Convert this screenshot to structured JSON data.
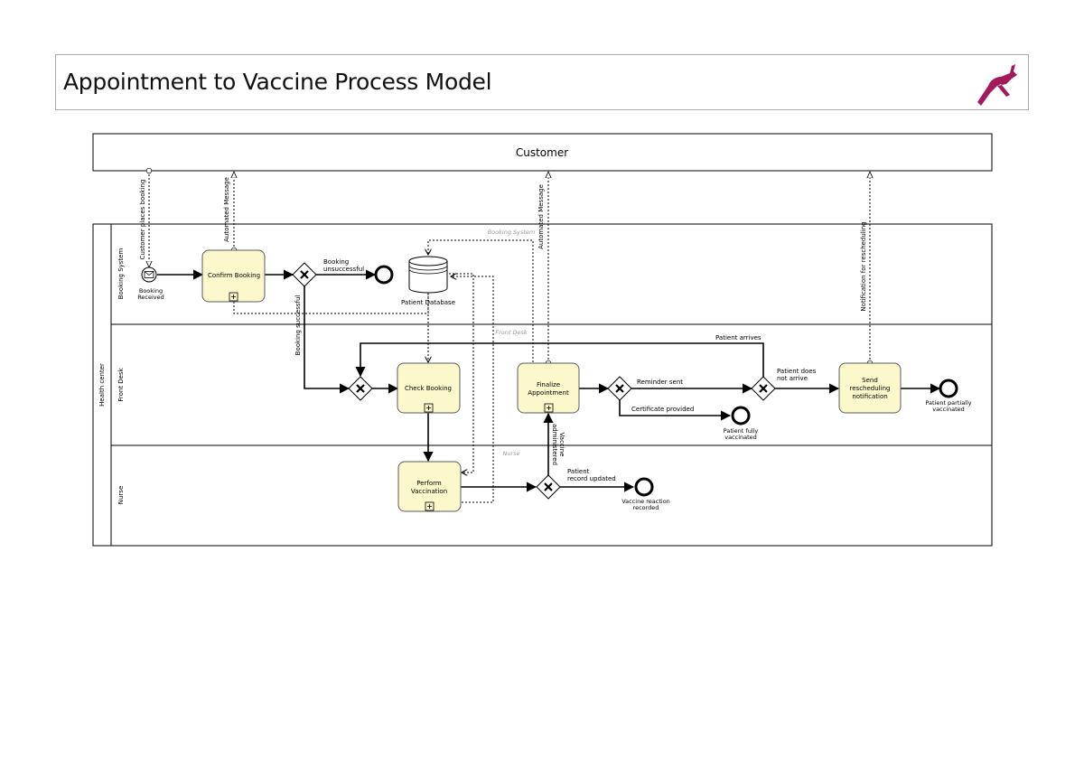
{
  "header": {
    "title": "Appointment to Vaccine Process Model",
    "logo_icon": "leaping-antelope-logo",
    "logo_color": "#a3195b"
  },
  "pools": {
    "customer": "Customer",
    "health_center": "Health center"
  },
  "lanes": {
    "booking_system": "Booking System",
    "front_desk": "Front Desk",
    "nurse": "Nurse"
  },
  "lane_watermarks": {
    "booking_system": "Booking System",
    "front_desk": "Front Desk",
    "nurse": "Nurse"
  },
  "tasks": {
    "confirm_booking": "Confirm Booking",
    "check_booking": "Check Booking",
    "finalize_appointment": [
      "Finalize",
      "Appointment"
    ],
    "perform_vaccination": [
      "Perform",
      "Vaccination"
    ],
    "send_rescheduling": [
      "Send",
      "rescheduling",
      "notification"
    ]
  },
  "events": {
    "booking_received": [
      "Booking",
      "Received"
    ],
    "patient_fully_vaccinated": [
      "Patient fully",
      "vaccinated"
    ],
    "patient_partially_vaccinated": [
      "Patient partially",
      "vaccinated"
    ],
    "vaccine_reaction_recorded": [
      "Vaccine reaction",
      "recorded"
    ]
  },
  "data_store": "Patient Database",
  "flow_labels": {
    "booking_unsuccessful": [
      "Booking",
      "unsuccessful"
    ],
    "booking_successful": "Booking successful",
    "reminder_sent": "Reminder sent",
    "certificate_provided": "Certificate provided",
    "patient_arrives": "Patient arrives",
    "patient_does_not_arrive": [
      "Patient does",
      "not arrive"
    ],
    "patient_record_updated": [
      "Patient",
      "record updated"
    ],
    "vaccine_administered": [
      "Vaccine",
      "administered"
    ]
  },
  "message_labels": {
    "customer_places_booking": "Customer places booking",
    "automated_message_1": "Automated Message",
    "automated_message_2": "Automated Message",
    "notification_rescheduling": "Notification for rescheduling"
  },
  "colors": {
    "task_fill": "#fbf8cc",
    "task_stroke": "#5c5c5c",
    "line": "#000000",
    "watermark": "#9a9a9a"
  }
}
